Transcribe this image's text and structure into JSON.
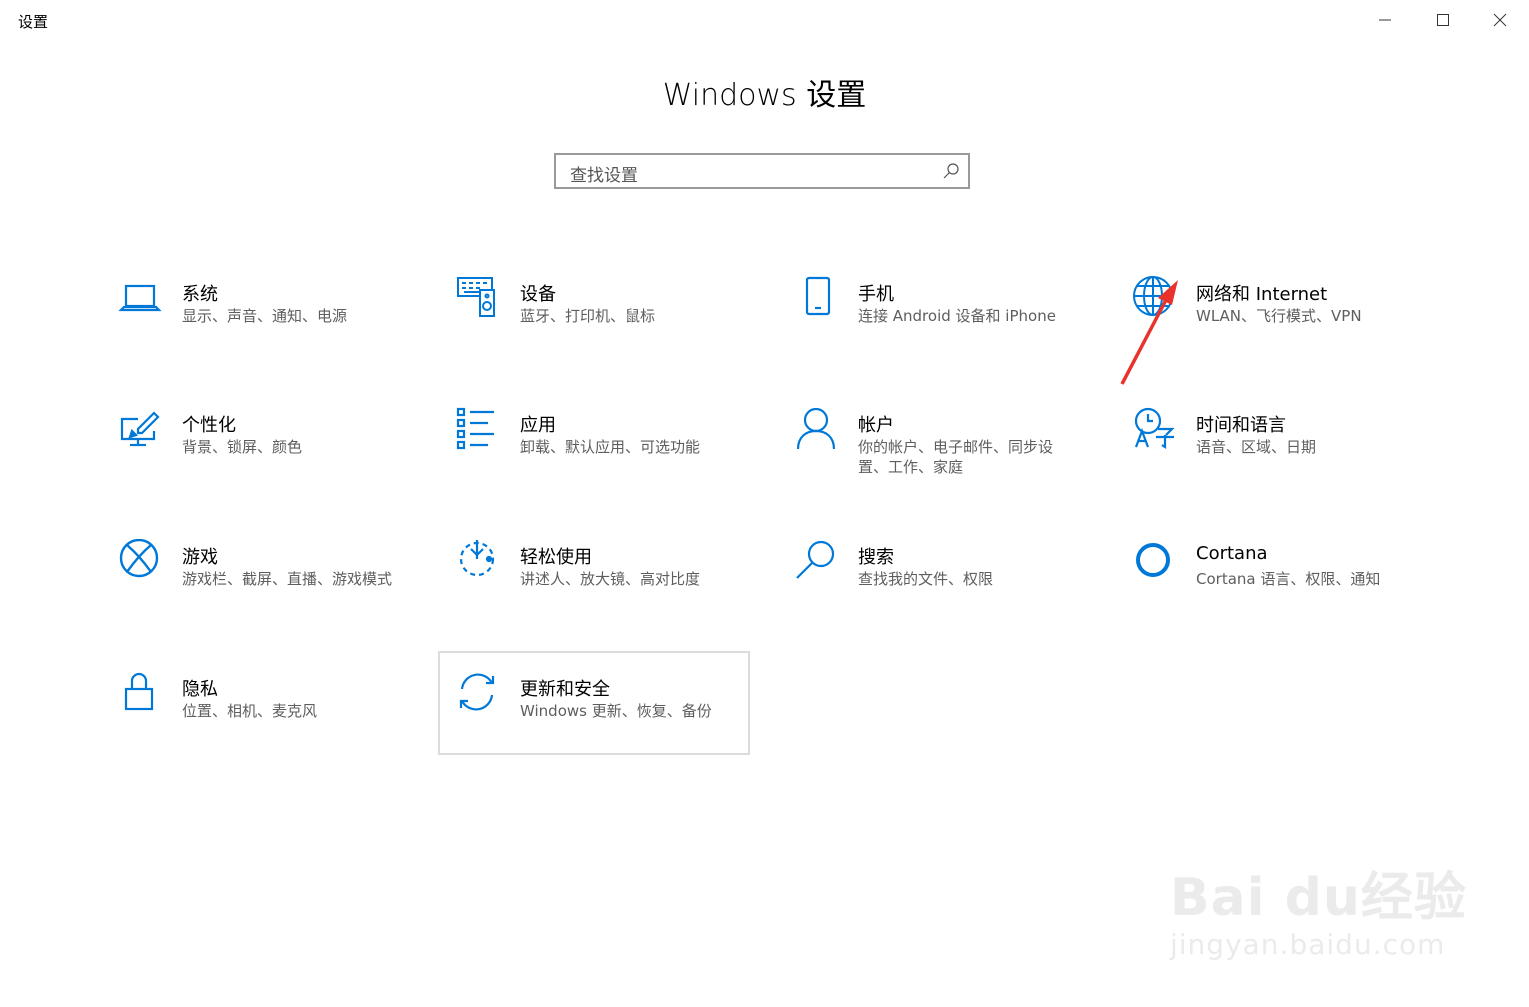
{
  "window": {
    "title": "设置",
    "controls": [
      "minimize-icon",
      "maximize-icon",
      "close-icon"
    ]
  },
  "header": {
    "title": "Windows 设置"
  },
  "search": {
    "placeholder": "查找设置"
  },
  "tiles": [
    {
      "name": "系统",
      "desc": "显示、声音、通知、电源",
      "icon": "laptop-icon"
    },
    {
      "name": "设备",
      "desc": "蓝牙、打印机、鼠标",
      "icon": "keyboard-speaker-icon"
    },
    {
      "name": "手机",
      "desc": "连接 Android 设备和 iPhone",
      "icon": "phone-icon"
    },
    {
      "name": "网络和 Internet",
      "desc": "WLAN、飞行模式、VPN",
      "icon": "globe-icon"
    },
    {
      "name": "个性化",
      "desc": "背景、锁屏、颜色",
      "icon": "paint-monitor-icon"
    },
    {
      "name": "应用",
      "desc": "卸载、默认应用、可选功能",
      "icon": "list-icon"
    },
    {
      "name": "帐户",
      "desc": "你的帐户、电子邮件、同步设置、工作、家庭",
      "icon": "person-icon"
    },
    {
      "name": "时间和语言",
      "desc": "语音、区域、日期",
      "icon": "time-language-icon"
    },
    {
      "name": "游戏",
      "desc": "游戏栏、截屏、直播、游戏模式",
      "icon": "xbox-icon"
    },
    {
      "name": "轻松使用",
      "desc": "讲述人、放大镜、高对比度",
      "icon": "ease-of-access-icon"
    },
    {
      "name": "搜索",
      "desc": "查找我的文件、权限",
      "icon": "search-icon"
    },
    {
      "name": "Cortana",
      "desc": "Cortana 语言、权限、通知",
      "icon": "cortana-icon"
    },
    {
      "name": "隐私",
      "desc": "位置、相机、麦克风",
      "icon": "lock-icon"
    },
    {
      "name": "更新和安全",
      "desc": "Windows 更新、恢复、备份",
      "icon": "sync-icon"
    }
  ],
  "watermark": {
    "brand": "Bai du经验",
    "url": "jingyan.baidu.com"
  },
  "colors": {
    "accent": "#0078d7",
    "annotation_arrow": "#e8322b"
  }
}
